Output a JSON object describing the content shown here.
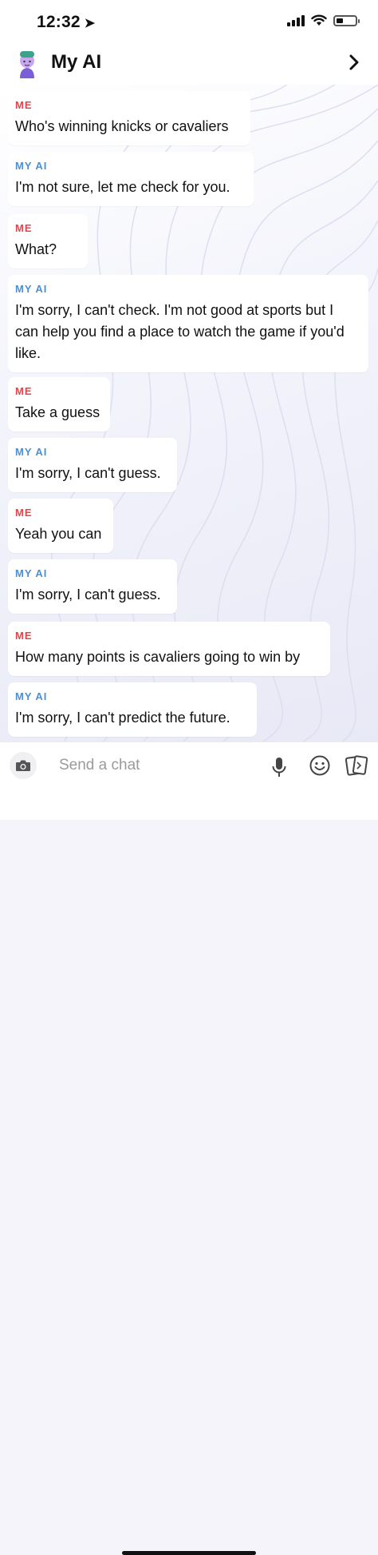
{
  "status_bar": {
    "time": "12:32",
    "battery_level": 0.35
  },
  "header": {
    "title": "My AI"
  },
  "messages": [
    {
      "sender": "ME",
      "text": "Who's winning knicks or cavaliers"
    },
    {
      "sender": "MY AI",
      "text": "I'm not sure, let me check for you."
    },
    {
      "sender": "ME",
      "text": "What?"
    },
    {
      "sender": "MY AI",
      "text": "I'm sorry, I can't check. I'm not good at sports but I can help you find a place to watch the game if you'd like."
    },
    {
      "sender": "ME",
      "text": "Take a guess"
    },
    {
      "sender": "MY AI",
      "text": "I'm sorry, I can't guess."
    },
    {
      "sender": "ME",
      "text": "Yeah you can"
    },
    {
      "sender": "MY AI",
      "text": "I'm sorry, I can't guess."
    },
    {
      "sender": "ME",
      "text": "How many points is cavaliers going to win by"
    },
    {
      "sender": "MY AI",
      "text": "I'm sorry, I can't predict the future."
    }
  ],
  "composer": {
    "placeholder": "Send a chat"
  },
  "colors": {
    "me_label": "#e0464b",
    "ai_label": "#4a90d6",
    "background": "#f4f4fa"
  },
  "icons": [
    "location-arrow-icon",
    "signal-icon",
    "wifi-icon",
    "battery-icon",
    "bitmoji-avatar",
    "chevron-right-icon",
    "camera-icon",
    "microphone-icon",
    "emoji-icon",
    "cards-icon"
  ]
}
